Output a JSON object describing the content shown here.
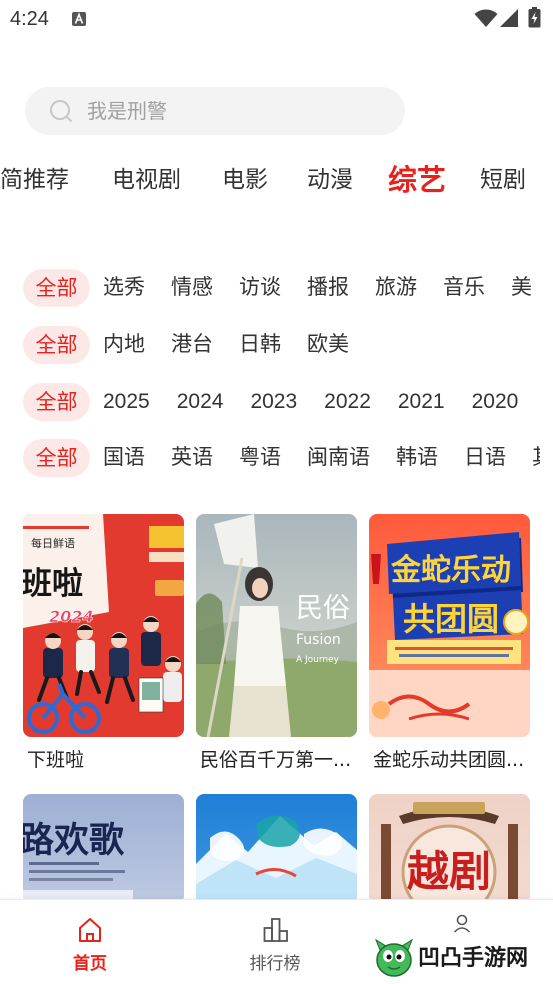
{
  "status_bar": {
    "time": "4:24",
    "icons": [
      "text-notification-icon",
      "wifi-icon",
      "cellular-signal-icon",
      "battery-charging-icon"
    ]
  },
  "search": {
    "placeholder": "我是刑警",
    "icon": "search-icon"
  },
  "category_tabs": [
    {
      "label": "简推荐",
      "active": false
    },
    {
      "label": "电视剧",
      "active": false
    },
    {
      "label": "电影",
      "active": false
    },
    {
      "label": "动漫",
      "active": false
    },
    {
      "label": "综艺",
      "active": true
    },
    {
      "label": "短剧",
      "active": false
    }
  ],
  "filters": [
    {
      "selected": "全部",
      "options": [
        "选秀",
        "情感",
        "访谈",
        "播报",
        "旅游",
        "音乐",
        "美"
      ]
    },
    {
      "selected": "全部",
      "options": [
        "内地",
        "港台",
        "日韩",
        "欧美"
      ]
    },
    {
      "selected": "全部",
      "options": [
        "2025",
        "2024",
        "2023",
        "2022",
        "2021",
        "2020"
      ]
    },
    {
      "selected": "全部",
      "options": [
        "国语",
        "英语",
        "粤语",
        "闽南语",
        "韩语",
        "日语",
        "其"
      ]
    }
  ],
  "shows": [
    {
      "title": "下班啦",
      "poster_text": [
        "每日鲜语",
        "班啦",
        "2024"
      ]
    },
    {
      "title": "民俗百千万第一...",
      "poster_text": [
        "民俗",
        "Fusion",
        "A Journey"
      ]
    },
    {
      "title": "金蛇乐动共团圆...",
      "poster_text": [
        "金蛇乐动",
        "共团圆"
      ]
    },
    {
      "poster_text": [
        "路欢歌"
      ]
    },
    {
      "poster_text": []
    },
    {
      "poster_text": [
        "越剧"
      ]
    }
  ],
  "bottom_nav": [
    {
      "label": "首页",
      "icon": "home-icon",
      "active": true
    },
    {
      "label": "排行榜",
      "icon": "ranking-icon",
      "active": false
    },
    {
      "icon": "profile-icon",
      "active": false
    }
  ],
  "watermark": {
    "text": "凹凸手游网",
    "icon": "mascot-icon"
  },
  "colors": {
    "accent": "#e8221b",
    "pill_background": "#fde8e8",
    "text": "#333333",
    "placeholder": "#a0a0a0",
    "search_background": "#f3f3f3"
  }
}
